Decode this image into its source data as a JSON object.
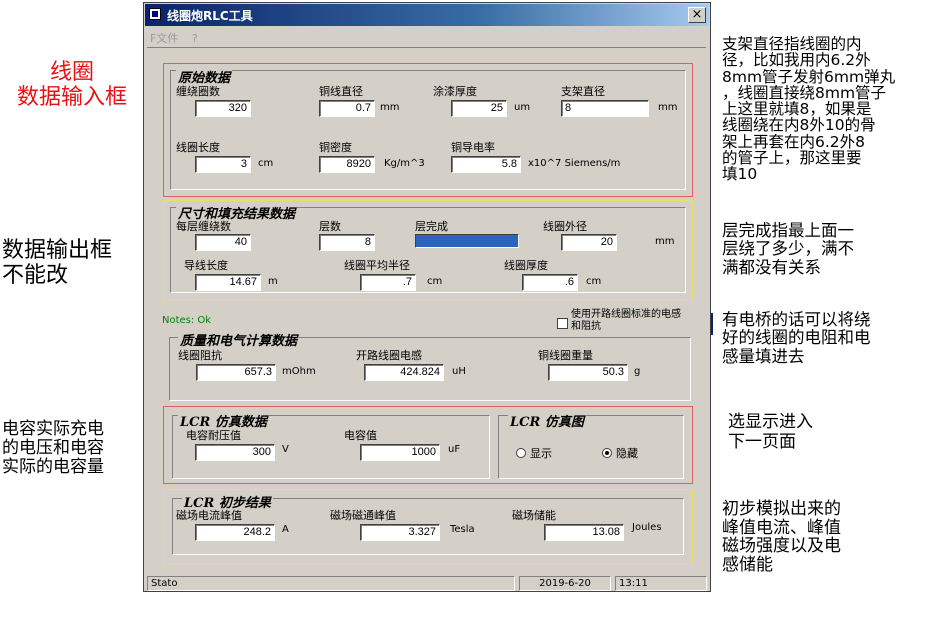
{
  "window": {
    "title": "线圈炮RLC工具",
    "close": "×"
  },
  "menu": {
    "file": "F文件",
    "help": "?"
  },
  "annotations": {
    "coil_input": "线圈\n数据输入框",
    "output_readonly": "数据输出框\n不能改",
    "cap_desc": "电容实际充电\n的电压和电容\n实际的电容量",
    "bracket_desc": "支架直径指线圈的内\n径，比如我用内6.2外\n8mm管子发射6mm弹丸\n，线圈直接绕8mm管子\n上这里就填8，如果是\n线圈绕在内8外10的骨\n架上再套在内6.2外8\n的管子上，那这里要\n填10",
    "layer_desc": "层完成指最上面一\n层绕了多少，满不\n满都没有关系",
    "bridge_desc": "有电桥的话可以将绕\n好的线圈的电阻和电\n感量填进去",
    "show_desc": "选显示进入\n下一页面",
    "result_desc": "初步模拟出来的\n峰值电流、峰值\n磁场强度以及电\n感储能"
  },
  "raw": {
    "title": "原始数据",
    "turns_label": "缠绕圈数",
    "turns": "320",
    "wire_dia_label": "铜线直径",
    "wire_dia": "0.7",
    "wire_dia_unit": "mm",
    "coat_label": "涂漆厚度",
    "coat": "25",
    "coat_unit": "um",
    "bracket_label": "支架直径",
    "bracket": "8",
    "bracket_unit": "mm",
    "length_label": "线圈长度",
    "length": "3",
    "length_unit": "cm",
    "density_label": "铜密度",
    "density": "8920",
    "density_unit": "Kg/m^3",
    "cond_label": "铜导电率",
    "cond": "5.8",
    "cond_unit": "x10^7 Siemens/m"
  },
  "size": {
    "title": "尺寸和填充结果数据",
    "per_layer_label": "每层缠绕数",
    "per_layer": "40",
    "layers_label": "层数",
    "layers": "8",
    "layer_done_label": "层完成",
    "layer_done_fraction": 1.0,
    "outer_label": "线圈外径",
    "outer": "20",
    "outer_unit": "mm",
    "wire_len_label": "导线长度",
    "wire_len": "14.67",
    "wire_len_unit": "m",
    "avg_r_label": "线圈平均半径",
    "avg_r": ".7",
    "avg_r_unit": "cm",
    "thick_label": "线圈厚度",
    "thick": ".6",
    "thick_unit": "cm"
  },
  "notes": "Notes: Ok",
  "std_check_label": "使用开路线圈标准的电感\n和阻抗",
  "elec": {
    "title": "质量和电气计算数据",
    "res_label": "线圈阻抗",
    "res": "657.3",
    "res_unit": "mOhm",
    "ind_label": "开路线圈电感",
    "ind": "424.824",
    "ind_unit": "uH",
    "mass_label": "铜线圈重量",
    "mass": "50.3",
    "mass_unit": "g"
  },
  "lcr": {
    "title": "LCR 仿真数据",
    "volt_label": "电容耐压值",
    "volt": "300",
    "volt_unit": "V",
    "cap_label": "电容值",
    "cap": "1000",
    "cap_unit": "uF"
  },
  "lcr_plot": {
    "title": "LCR 仿真图",
    "show": "显示",
    "hide": "隐藏",
    "selected": "hide"
  },
  "lcr_result": {
    "title": "LCR 初步结果",
    "peak_i_label": "磁场电流峰值",
    "peak_i": "248.2",
    "peak_i_unit": "A",
    "peak_b_label": "磁场磁通峰值",
    "peak_b": "3.327",
    "peak_b_unit": "Tesla",
    "energy_label": "磁场储能",
    "energy": "13.08",
    "energy_unit": "Joules"
  },
  "status": {
    "text": "Stato",
    "date": "2019-6-20",
    "time": "13:11"
  },
  "colors": {
    "annotation_red": "#e81010",
    "titlebar": "#0a246a",
    "progress": "#2a63c0"
  }
}
